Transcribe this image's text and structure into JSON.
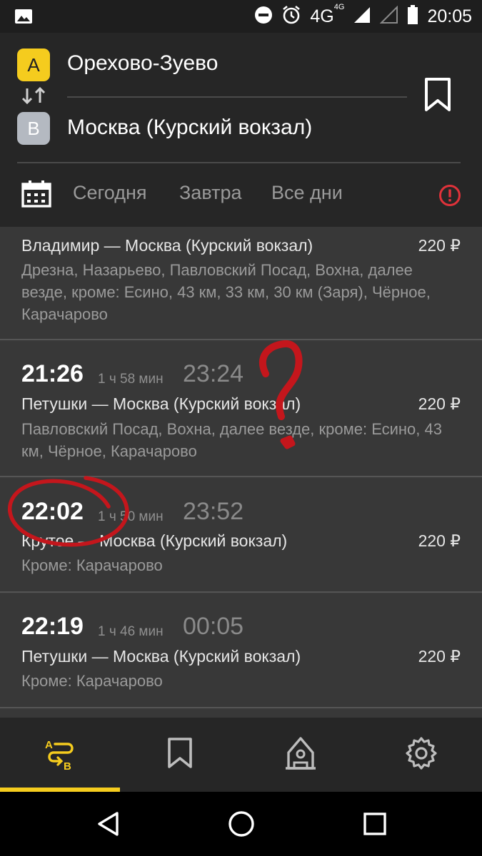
{
  "status_bar": {
    "network": "4G",
    "network_sup": "4G",
    "time": "20:05"
  },
  "route": {
    "from_badge": "A",
    "from": "Орехово-Зуево",
    "to_badge": "B",
    "to": "Москва (Курский вокзал)"
  },
  "day_tabs": {
    "today": "Сегодня",
    "tomorrow": "Завтра",
    "all": "Все дни"
  },
  "trains": [
    {
      "depart": "",
      "duration": "",
      "arrive": "",
      "route": "Владимир — Москва (Курский вокзал)",
      "price": "220 ₽",
      "stops": "Дрезна, Назарьево, Павловский Посад, Вохна, далее везде, кроме: Есино, 43 км, 33 км, 30 км (Заря), Чёрное, Карачарово"
    },
    {
      "depart": "21:26",
      "duration": "1 ч 58 мин",
      "arrive": "23:24",
      "route": "Петушки — Москва (Курский вокзал)",
      "price": "220 ₽",
      "stops": "Павловский Посад, Вохна, далее везде, кроме: Есино, 43 км, Чёрное, Карачарово"
    },
    {
      "depart": "22:02",
      "duration": "1 ч 50 мин",
      "arrive": "23:52",
      "route": "Крутое — Москва (Курский вокзал)",
      "price": "220 ₽",
      "stops": "Кроме: Карачарово"
    },
    {
      "depart": "22:19",
      "duration": "1 ч 46 мин",
      "arrive": "00:05",
      "route": "Петушки — Москва (Курский вокзал)",
      "price": "220 ₽",
      "stops": "Кроме: Карачарово"
    }
  ],
  "bottom_nav": {
    "items": [
      "route-search-icon",
      "bookmark-icon",
      "station-icon",
      "gear-icon"
    ],
    "active": 0
  },
  "colors": {
    "accent": "#f5cc1e",
    "alert": "#e0323a",
    "annotation": "#c4161c"
  }
}
